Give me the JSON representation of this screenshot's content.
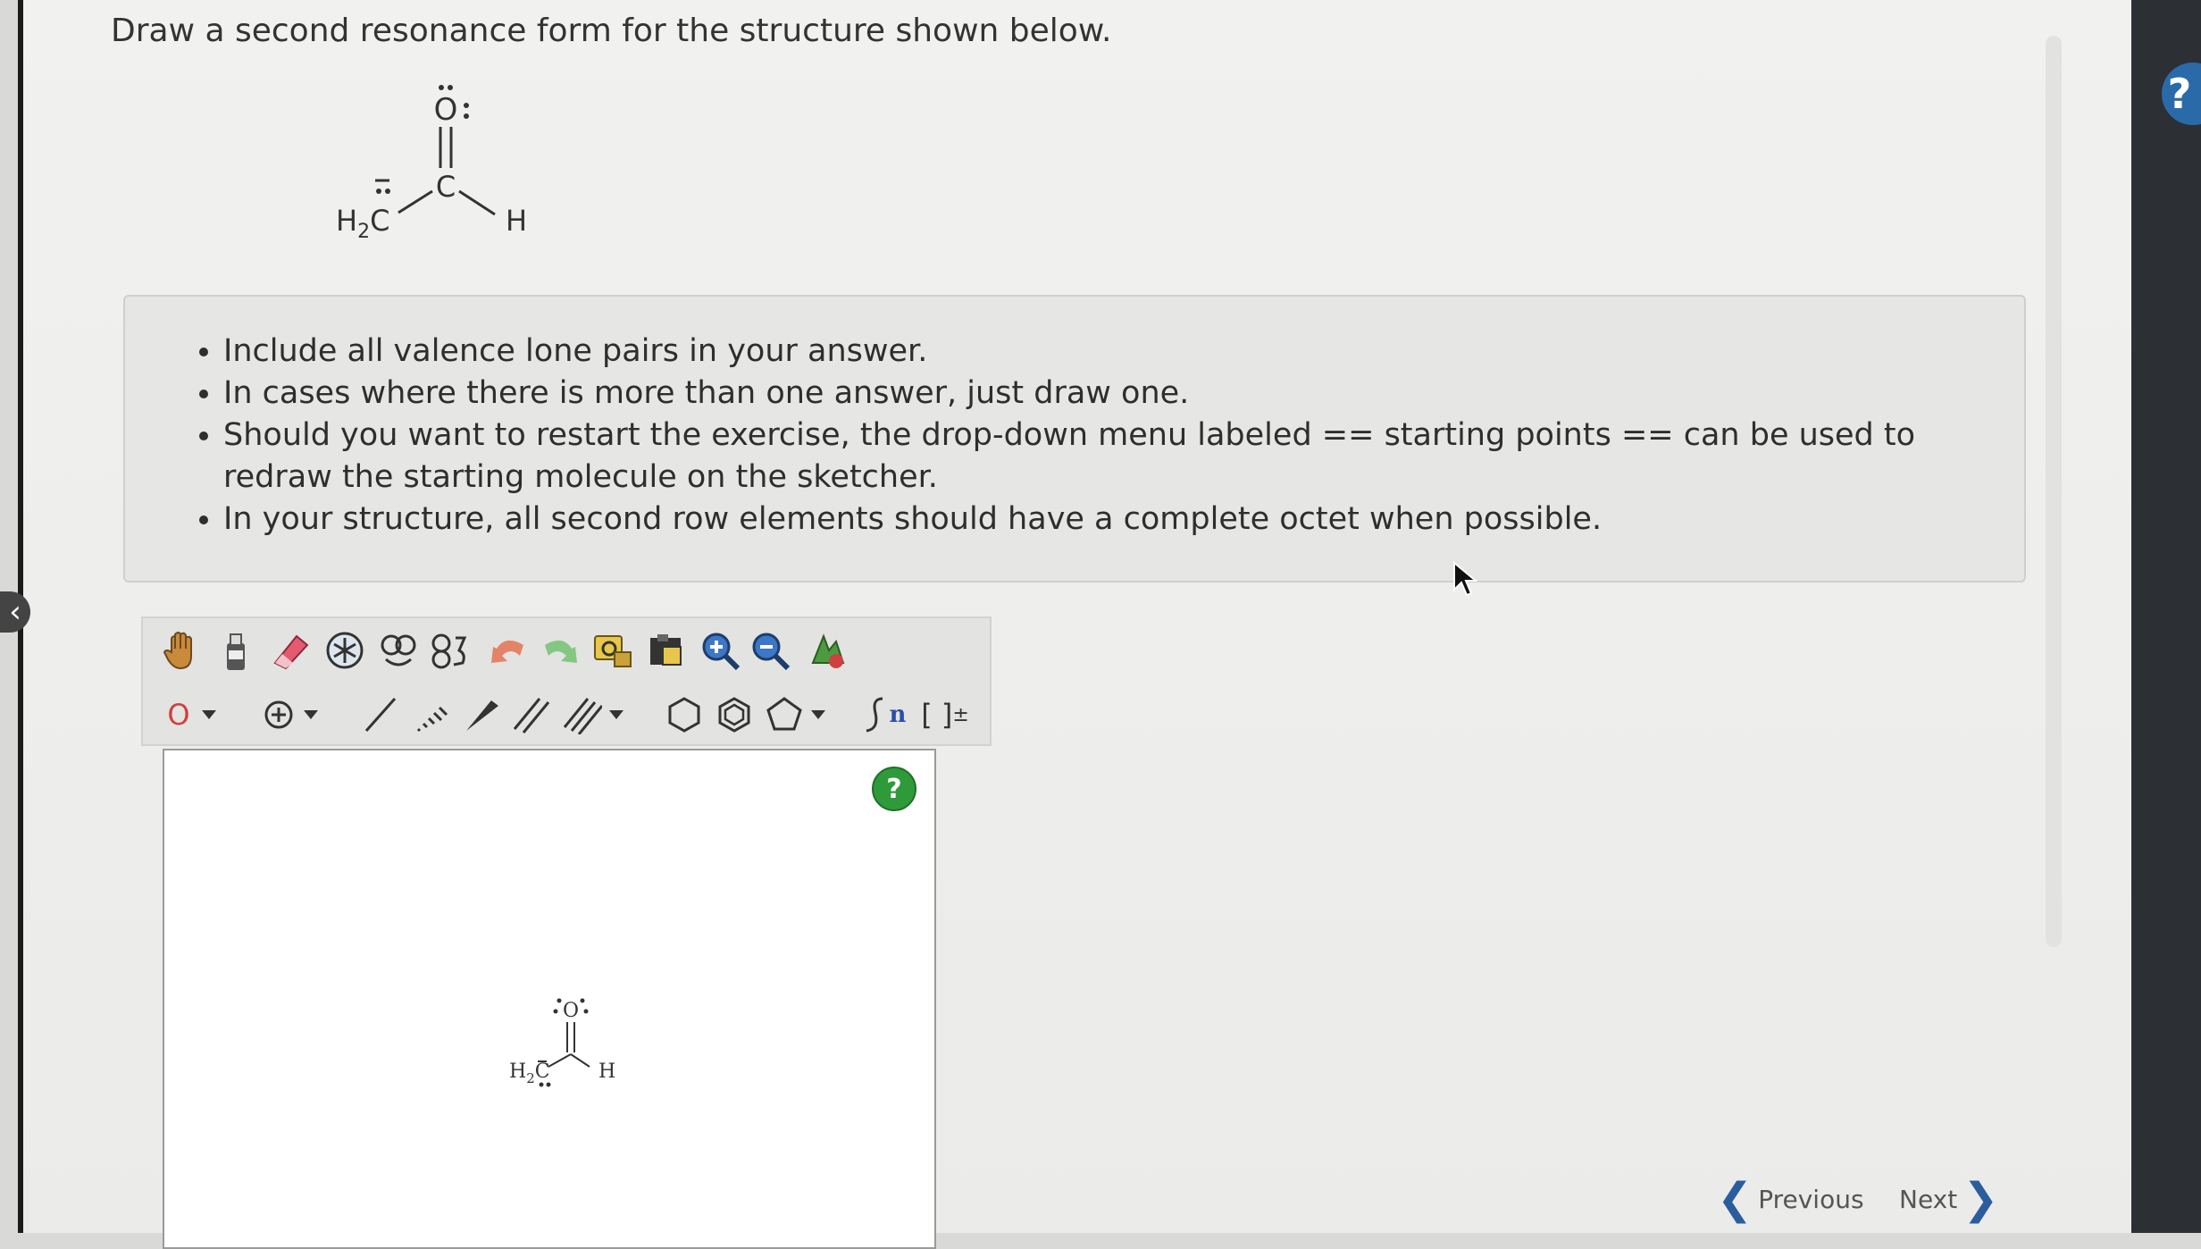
{
  "question": "Draw a second resonance form for the structure shown below.",
  "structure": {
    "top_atom": "O",
    "center_atom": "C",
    "left_group_main": "H",
    "left_group_sub": "2",
    "left_group_end": "C",
    "right_atom": "H"
  },
  "instructions": [
    "Include all valence lone pairs in your answer.",
    "In cases where there is more than one answer, just draw one.",
    "Should you want to restart the exercise, the drop-down menu labeled == starting points == can be used to redraw the starting molecule on the sketcher.",
    "In your structure, all second row elements should have a complete octet when possible."
  ],
  "toolbar": {
    "atom_selector": "O",
    "bracket_label": "[ ]",
    "bracket_sup": "±",
    "chain_label": "n"
  },
  "canvas": {
    "help_label": "?",
    "mini_structure": {
      "top_atom": "O",
      "left_group": "H",
      "left_sub": "2",
      "left_end": "C",
      "right_atom": "H"
    }
  },
  "nav": {
    "previous": "Previous",
    "next": "Next"
  },
  "side_help_label": "?",
  "colors": {
    "accent_blue": "#2a6aa8",
    "help_green": "#2f9a3a",
    "atom_red": "#d04040"
  }
}
